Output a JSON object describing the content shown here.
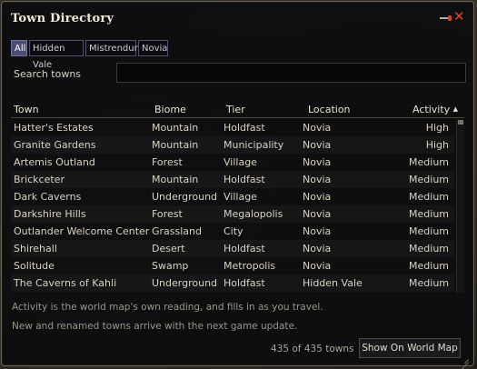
{
  "window": {
    "title": "Town Directory"
  },
  "tabs": [
    "All",
    "Hidden Vale",
    "Mistrendur",
    "Novia"
  ],
  "search": {
    "label": "Search towns",
    "value": "",
    "placeholder": ""
  },
  "columns": {
    "town": "Town",
    "biome": "Biome",
    "tier": "Tier",
    "location": "Location",
    "activity": "Activity",
    "sort_indicator": "▲"
  },
  "rows": [
    [
      "Hatter's Estates",
      "Mountain",
      "Holdfast",
      "Novia",
      "High"
    ],
    [
      "Granite Gardens",
      "Mountain",
      "Municipality",
      "Novia",
      "High"
    ],
    [
      "Artemis Outland",
      "Forest",
      "Village",
      "Novia",
      "Medium"
    ],
    [
      "Brickceter",
      "Mountain",
      "Holdfast",
      "Novia",
      "Medium"
    ],
    [
      "Dark Caverns",
      "Underground",
      "Village",
      "Novia",
      "Medium"
    ],
    [
      "Darkshire Hills",
      "Forest",
      "Megalopolis",
      "Novia",
      "Medium"
    ],
    [
      "Outlander Welcome Center",
      "Grassland",
      "City",
      "Novia",
      "Medium"
    ],
    [
      "Shirehall",
      "Desert",
      "Holdfast",
      "Novia",
      "Medium"
    ],
    [
      "Solitude",
      "Swamp",
      "Metropolis",
      "Novia",
      "Medium"
    ],
    [
      "The Caverns of Kahli",
      "Underground",
      "Holdfast",
      "Hidden Vale",
      "Medium"
    ]
  ],
  "footer": {
    "note1": "Activity is the world map's own reading, and fills in as you travel.",
    "note2": "New and renamed towns arrive with the next game update.",
    "count": "435 of 435 towns",
    "map_button": "Show On World Map"
  },
  "colors": {
    "accent": "#4a4f72",
    "close": "#d84b2f",
    "window_bg": "#0c0c0e"
  },
  "icons": {
    "close": "close-icon",
    "pin": "pin-icon",
    "resize": "resize-grip-icon"
  }
}
